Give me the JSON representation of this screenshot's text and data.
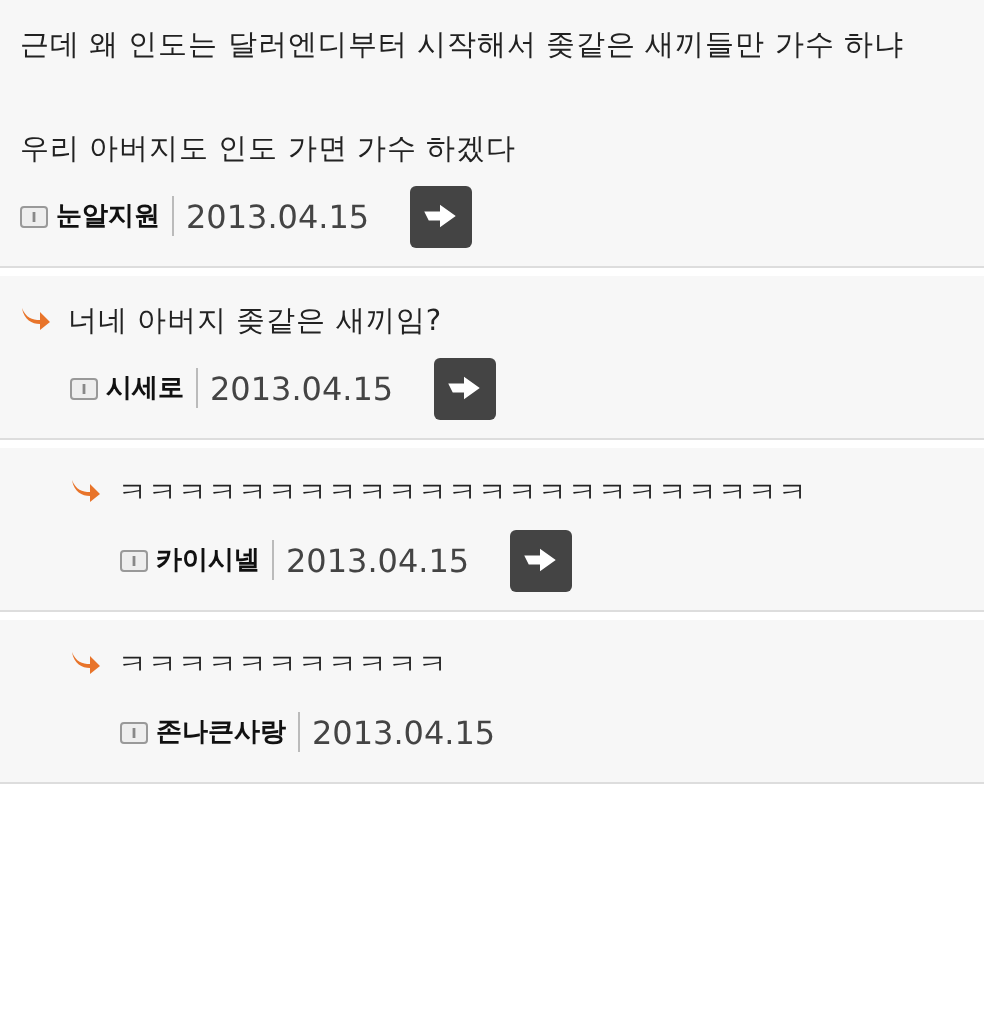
{
  "comments": [
    {
      "text": "근데 왜 인도는 달러엔디부터 시작해서 좆같은 새끼들만 가수 하냐\n\n우리 아버지도 인도 가면 가수 하겠다",
      "author": "눈알지원",
      "date": "2013.04.15",
      "reply_button": true,
      "children": [
        {
          "text": "너네 아버지 좆같은 새끼임?",
          "author": "시세로",
          "date": "2013.04.15",
          "reply_button": true,
          "children": [
            {
              "text": "ㅋㅋㅋㅋㅋㅋㅋㅋㅋㅋㅋㅋㅋㅋㅋㅋㅋㅋㅋㅋㅋㅋㅋ",
              "author": "카이시넬",
              "date": "2013.04.15",
              "reply_button": true
            },
            {
              "text": "ㅋㅋㅋㅋㅋㅋㅋㅋㅋㅋㅋ",
              "author": "존나큰사랑",
              "date": "2013.04.15",
              "reply_button": false
            }
          ]
        }
      ]
    }
  ]
}
